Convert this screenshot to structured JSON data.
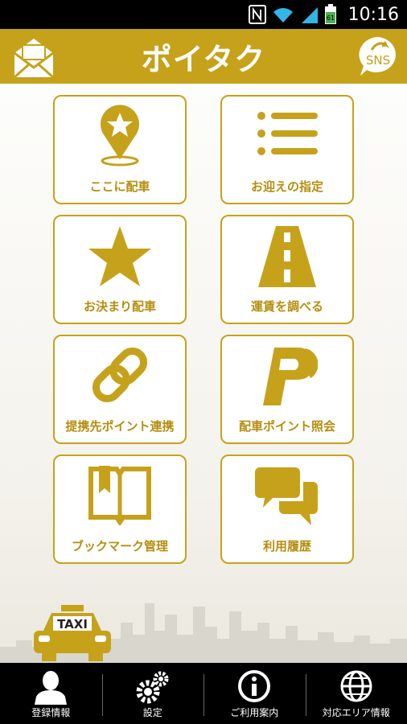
{
  "status_bar": {
    "time": "10:16",
    "battery_level": "61"
  },
  "header": {
    "title": "ポイタク",
    "sns_label": "SNS"
  },
  "menu": [
    {
      "label": "ここに配車",
      "icon": "map-pin-star-icon"
    },
    {
      "label": "お迎えの指定",
      "icon": "list-icon"
    },
    {
      "label": "お決まり配車",
      "icon": "star-icon"
    },
    {
      "label": "運賃を調べる",
      "icon": "road-icon"
    },
    {
      "label": "提携先ポイント連携",
      "icon": "link-icon"
    },
    {
      "label": "配車ポイント照会",
      "icon": "p-points-icon"
    },
    {
      "label": "ブックマーク管理",
      "icon": "bookmark-book-icon"
    },
    {
      "label": "利用履歴",
      "icon": "chat-bubbles-icon"
    }
  ],
  "taxi_sign": "TAXI",
  "bottom_nav": [
    {
      "label": "登録情報",
      "icon": "user-icon"
    },
    {
      "label": "設定",
      "icon": "gears-icon"
    },
    {
      "label": "ご利用案内",
      "icon": "info-icon"
    },
    {
      "label": "対応エリア情報",
      "icon": "globe-icon"
    }
  ],
  "colors": {
    "accent": "#c6a21b",
    "label": "#b58e0e"
  }
}
